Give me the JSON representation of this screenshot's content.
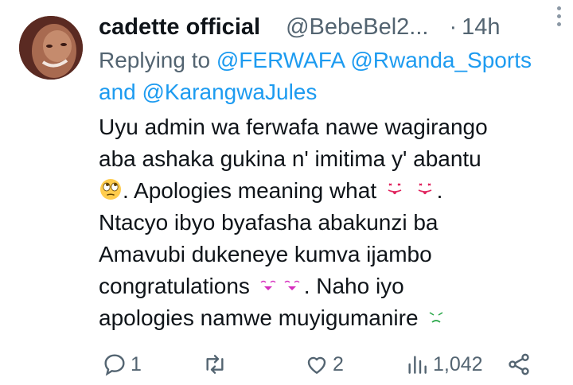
{
  "tweet": {
    "display_name": "cadette official",
    "handle": "@BebeBel2...",
    "separator": "·",
    "time": "14h",
    "replying_prefix": "Replying to",
    "mention_1": "@FERWAFA",
    "mention_2": "@Rwanda_Sports",
    "replying_and": "and",
    "mention_3": "@KarangwaJules",
    "line_1": "Uyu admin wa ferwafa nawe wagirango",
    "line_2": "aba ashaka gukina n' imitima y' abantu",
    "line_3_text": ". Apologies meaning what",
    "line_3_end": ".",
    "line_4": "Ntacyo ibyo byafasha abakunzi ba",
    "line_5": "Amavubi dukeneye kumva ijambo",
    "line_6_text": "congratulations",
    "line_6_end": ". Naho iyo",
    "line_7": "apologies namwe muyigumanire"
  },
  "emojis": {
    "eye_roll": "face-with-rolling-eyes-icon",
    "tongue": "face-with-tongue-icon",
    "kissing": "kissing-face-icon",
    "disappointed": "disappointed-face-icon"
  },
  "actions": {
    "reply_count": "1",
    "retweet_count": "",
    "like_count": "2",
    "views_count": "1,042"
  },
  "colors": {
    "link": "#1d9bf0",
    "secondary": "#536471",
    "primary_text": "#0f1419",
    "background": "#ffffff"
  }
}
